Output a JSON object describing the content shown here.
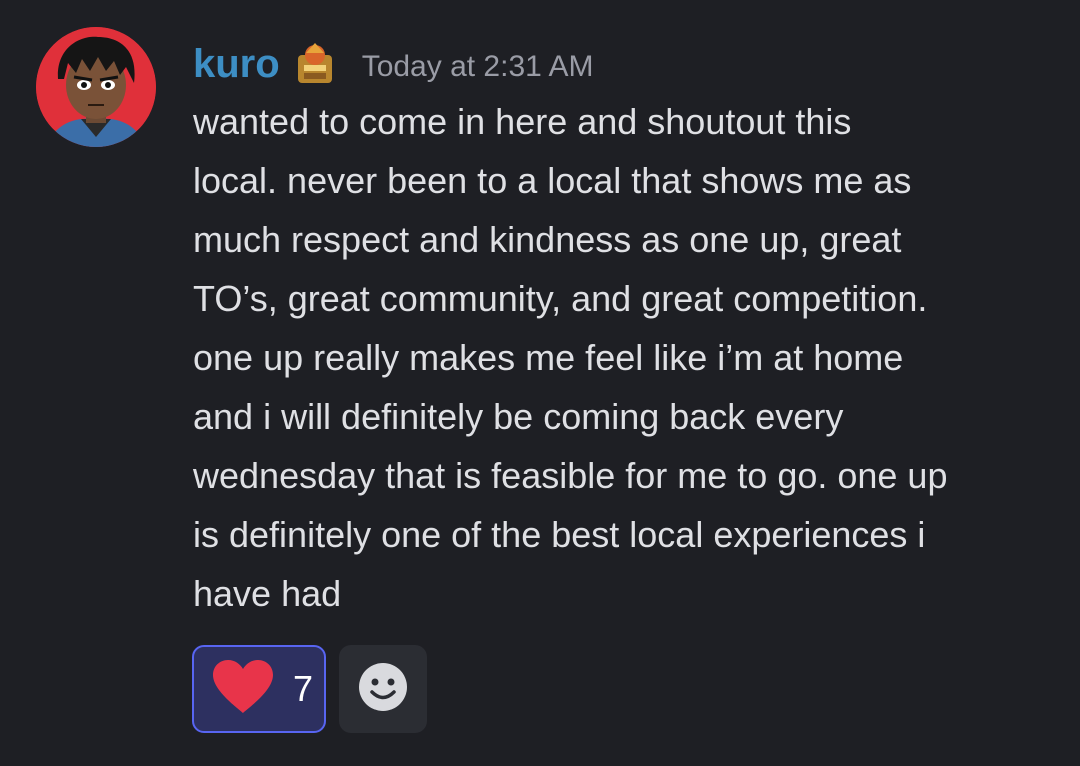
{
  "message": {
    "author": "kuro",
    "timestamp": "Today at 2:31 AM",
    "content_lines": [
      "wanted to come in here and shoutout this",
      "local. never been to a local that shows me as",
      "much respect and kindness as one up, great",
      "TO’s, great community, and great competition.",
      "one up really makes me feel like i’m at home",
      "and i will definitely be coming back every",
      "wednesday that is feasible for me to go. one up",
      "is definitely one of the best local experiences i",
      "have had"
    ]
  },
  "reactions": [
    {
      "icon": "heart-icon",
      "count": "7",
      "selected": true
    }
  ],
  "add_reaction": {
    "icon": "smiley-face-icon"
  },
  "colors": {
    "background": "#1e1f24",
    "username": "#3d8ec4",
    "timestamp": "#9a9ca6",
    "text": "#dfe0e4",
    "reaction_selected_bg": "#2d3060",
    "reaction_selected_border": "#5865f2",
    "heart": "#e8344a"
  }
}
